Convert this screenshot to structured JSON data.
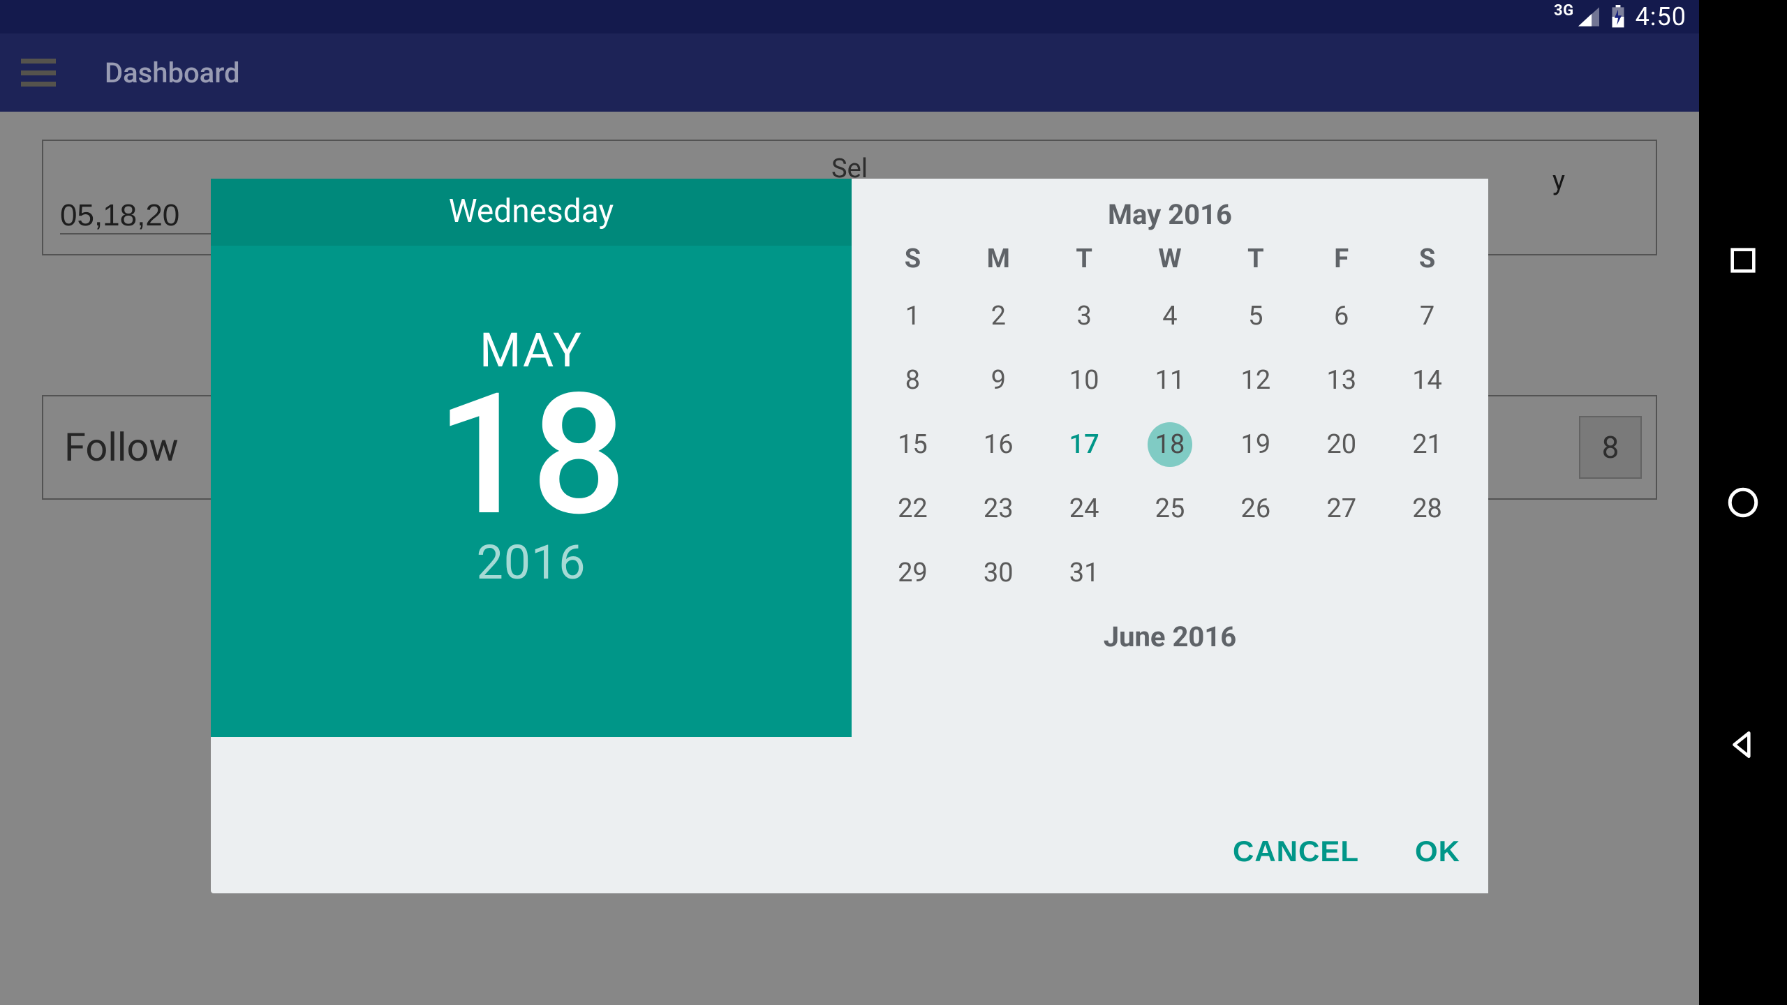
{
  "status": {
    "network": "3G",
    "clock": "4:50"
  },
  "appbar": {
    "title": "Dashboard"
  },
  "page": {
    "select_label": "Sel",
    "date_value": "05,18,20",
    "right_label": "y",
    "follow_label": "Follow",
    "badge_value": "8"
  },
  "datepicker": {
    "weekday": "Wednesday",
    "month_abbr": "MAY",
    "day": "18",
    "year": "2016",
    "calendar": {
      "month_title": "May 2016",
      "next_month_title": "June 2016",
      "dow": [
        "S",
        "M",
        "T",
        "W",
        "T",
        "F",
        "S"
      ],
      "lead_blanks": 0,
      "days": 31,
      "today": 17,
      "selected": 18
    },
    "actions": {
      "cancel": "CANCEL",
      "ok": "OK"
    }
  },
  "nav": {
    "back": "back",
    "home": "home",
    "recent": "recent"
  }
}
